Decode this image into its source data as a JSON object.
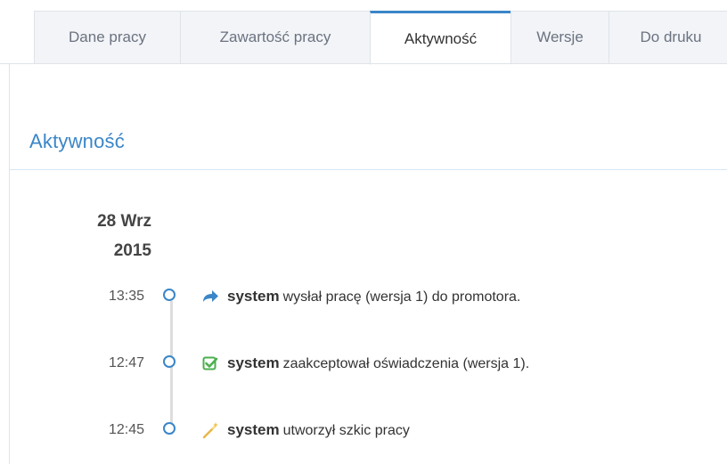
{
  "tabs": [
    {
      "label": "Dane pracy",
      "active": false
    },
    {
      "label": "Zawartość pracy",
      "active": false
    },
    {
      "label": "Aktywność",
      "active": true
    },
    {
      "label": "Wersje",
      "active": false
    },
    {
      "label": "Do druku",
      "active": false
    }
  ],
  "section": {
    "title": "Aktywność"
  },
  "date": {
    "day_month": "28 Wrz",
    "year": "2015"
  },
  "entries": [
    {
      "time": "13:35",
      "icon": "share-arrow-icon",
      "actor": "system",
      "text": "wysłał pracę (wersja 1) do promotora."
    },
    {
      "time": "12:47",
      "icon": "check-square-icon",
      "actor": "system",
      "text": "zaakceptował oświadczenia (wersja 1)."
    },
    {
      "time": "12:45",
      "icon": "magic-wand-icon",
      "actor": "system",
      "text": "utworzył szkic pracy"
    }
  ],
  "colors": {
    "accent": "#3a86c8",
    "check": "#4caf50",
    "wand": "#f0c24a"
  }
}
